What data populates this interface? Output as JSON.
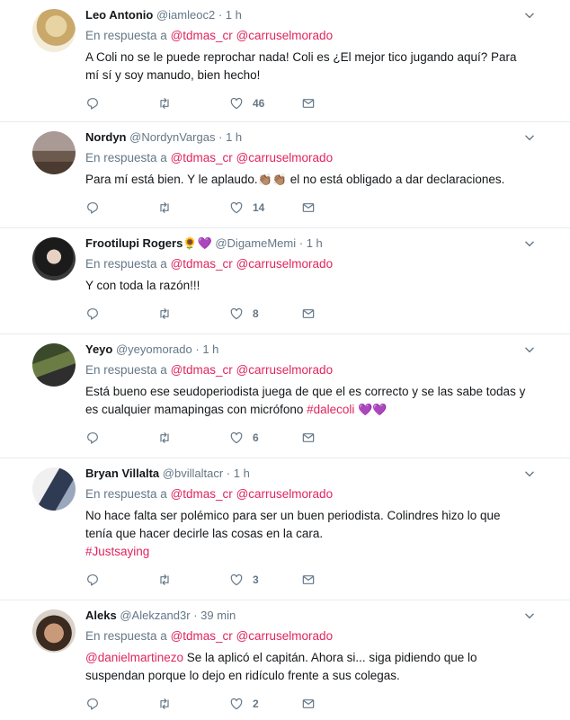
{
  "reply_prefix": "En respuesta a",
  "colors": {
    "link": "#e0245e",
    "muted": "#657786",
    "divider": "#e6ecf0"
  },
  "tweets": [
    {
      "name": "Leo Antonio",
      "handle": "@iamleoc2",
      "time": "1 h",
      "replying_to": [
        "@tdmas_cr",
        "@carruselmorado"
      ],
      "text_lines": [
        "A Coli no se le puede reprochar nada! Coli es ¿El mejor tico jugando aquí? Para",
        "mí sí y soy manudo, bien hecho!"
      ],
      "likes": "46"
    },
    {
      "name": "Nordyn",
      "handle": "@NordynVargas",
      "time": "1 h",
      "replying_to": [
        "@tdmas_cr",
        "@carruselmorado"
      ],
      "text_before": "Para mí está bien. Y le aplaudo.",
      "text_emoji": "👏🏽👏🏽",
      "text_after": " el no está obligado a dar declaraciones.",
      "likes": "14"
    },
    {
      "name": "Frootilupi Rogers",
      "name_emoji_1": "🌻",
      "name_emoji_2": "💜",
      "handle": "@DigameMemi",
      "time": "1 h",
      "replying_to": [
        "@tdmas_cr",
        "@carruselmorado"
      ],
      "text_lines": [
        "Y con toda la razón!!!"
      ],
      "likes": "8"
    },
    {
      "name": "Yeyo",
      "handle": "@yeyomorado",
      "time": "1 h",
      "replying_to": [
        "@tdmas_cr",
        "@carruselmorado"
      ],
      "text_line1": "Está bueno ese seudoperiodista juega de que el es correcto y se las sabe todas y",
      "text_line2_before": "es cualquier mamapingas con micrófono ",
      "hashtag": "#dalecoli",
      "text_emoji": " 💜💜",
      "likes": "6"
    },
    {
      "name": "Bryan Villalta",
      "handle": "@bvillaltacr",
      "time": "1 h",
      "replying_to": [
        "@tdmas_cr",
        "@carruselmorado"
      ],
      "text_lines": [
        "No hace falta ser polémico para ser un buen periodista. Colindres hizo lo que",
        "tenía que hacer decirle las cosas en la cara."
      ],
      "hashtag": "#Justsaying",
      "likes": "3"
    },
    {
      "name": "Aleks",
      "handle": "@Alekzand3r",
      "time": "39 min",
      "replying_to": [
        "@tdmas_cr",
        "@carruselmorado"
      ],
      "mention": "@danielmartinezo",
      "text_line1_after": " Se la aplicó el capitán. Ahora si... siga pidiendo que lo",
      "text_line2": "suspendan porque lo dejo en ridículo frente a sus colegas.",
      "likes": "2"
    }
  ]
}
